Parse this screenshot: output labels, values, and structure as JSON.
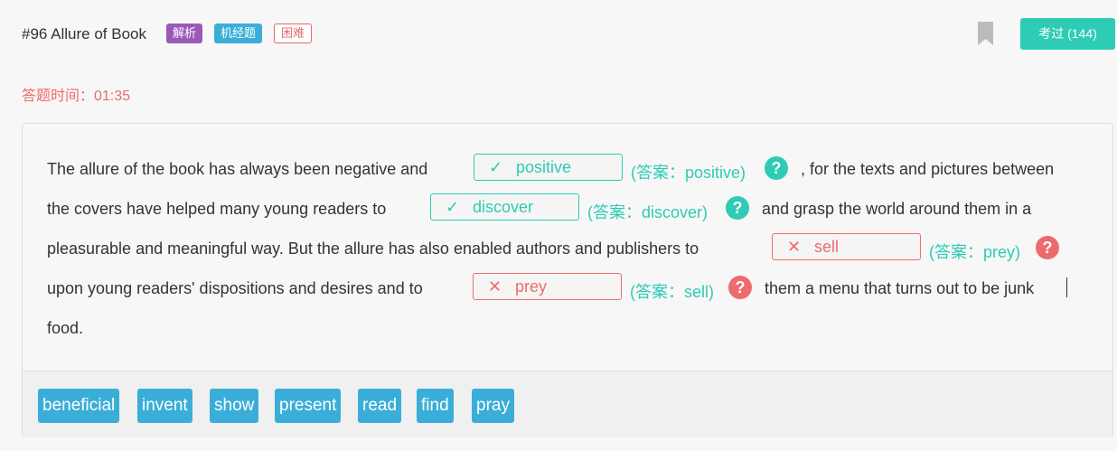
{
  "header": {
    "title": "#96 Allure of Book",
    "tags": [
      "解析",
      "机经题",
      "困难"
    ],
    "passed_button": "考过 (144)"
  },
  "timer": "答题时间：01:35",
  "passage": {
    "line1_a": "The allure of the book has always been negative and",
    "line1_b": ", for the texts and pictures between",
    "line2_a": "the covers have helped many young readers to",
    "line2_b": "and grasp the world around them in a",
    "line3_a": "pleasurable and meaningful way. But the allure has also enabled authors and publishers to",
    "line4_a": "upon young readers' dispositions and desires and to",
    "line4_b": "them a menu that turns out to be junk",
    "line5_a": "food."
  },
  "blanks": [
    {
      "mark": "✓",
      "value": "positive",
      "answer": "(答案：positive)",
      "status": "correct"
    },
    {
      "mark": "✓",
      "value": "discover",
      "answer": "(答案：discover)",
      "status": "correct"
    },
    {
      "mark": "✕",
      "value": "sell",
      "answer": "(答案：prey)",
      "status": "wrong"
    },
    {
      "mark": "✕",
      "value": "prey",
      "answer": "(答案：sell)",
      "status": "wrong"
    }
  ],
  "help_glyph": "?",
  "options": [
    "beneficial",
    "invent",
    "show",
    "present",
    "read",
    "find",
    "pray"
  ],
  "colors": {
    "correct": "#2ecbb5",
    "wrong": "#ee6b6b",
    "option": "#3aaed8",
    "analysis_tag": "#9b59b6"
  }
}
